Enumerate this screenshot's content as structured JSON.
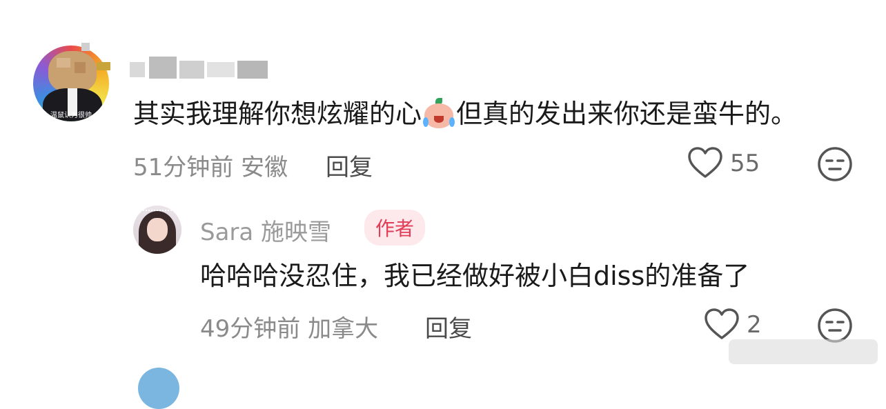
{
  "comment": {
    "text_before_emoji": "其实我理解你想炫耀的心",
    "emoji": "crying-laughing-peach-emoji",
    "text_after_emoji": "但真的发出来你还是蛮牛的。",
    "time": "51分钟前",
    "location": "安徽",
    "reply_label": "回复",
    "likes": "55",
    "avatar_caption": "温鼠认为很帅"
  },
  "reply": {
    "username": "Sara 施映雪",
    "badge": "作者",
    "text": "哈哈哈没忍住，我已经做好被小白diss的准备了",
    "time": "49分钟前",
    "location": "加拿大",
    "reply_label": "回复",
    "likes": "2"
  },
  "icons": {
    "like": "heart-outline-icon",
    "emoji_react": "neutral-face-icon"
  },
  "colors": {
    "badge_bg": "#fde9ec",
    "badge_text": "#e33b55",
    "meta_text": "#8a8a8a"
  }
}
